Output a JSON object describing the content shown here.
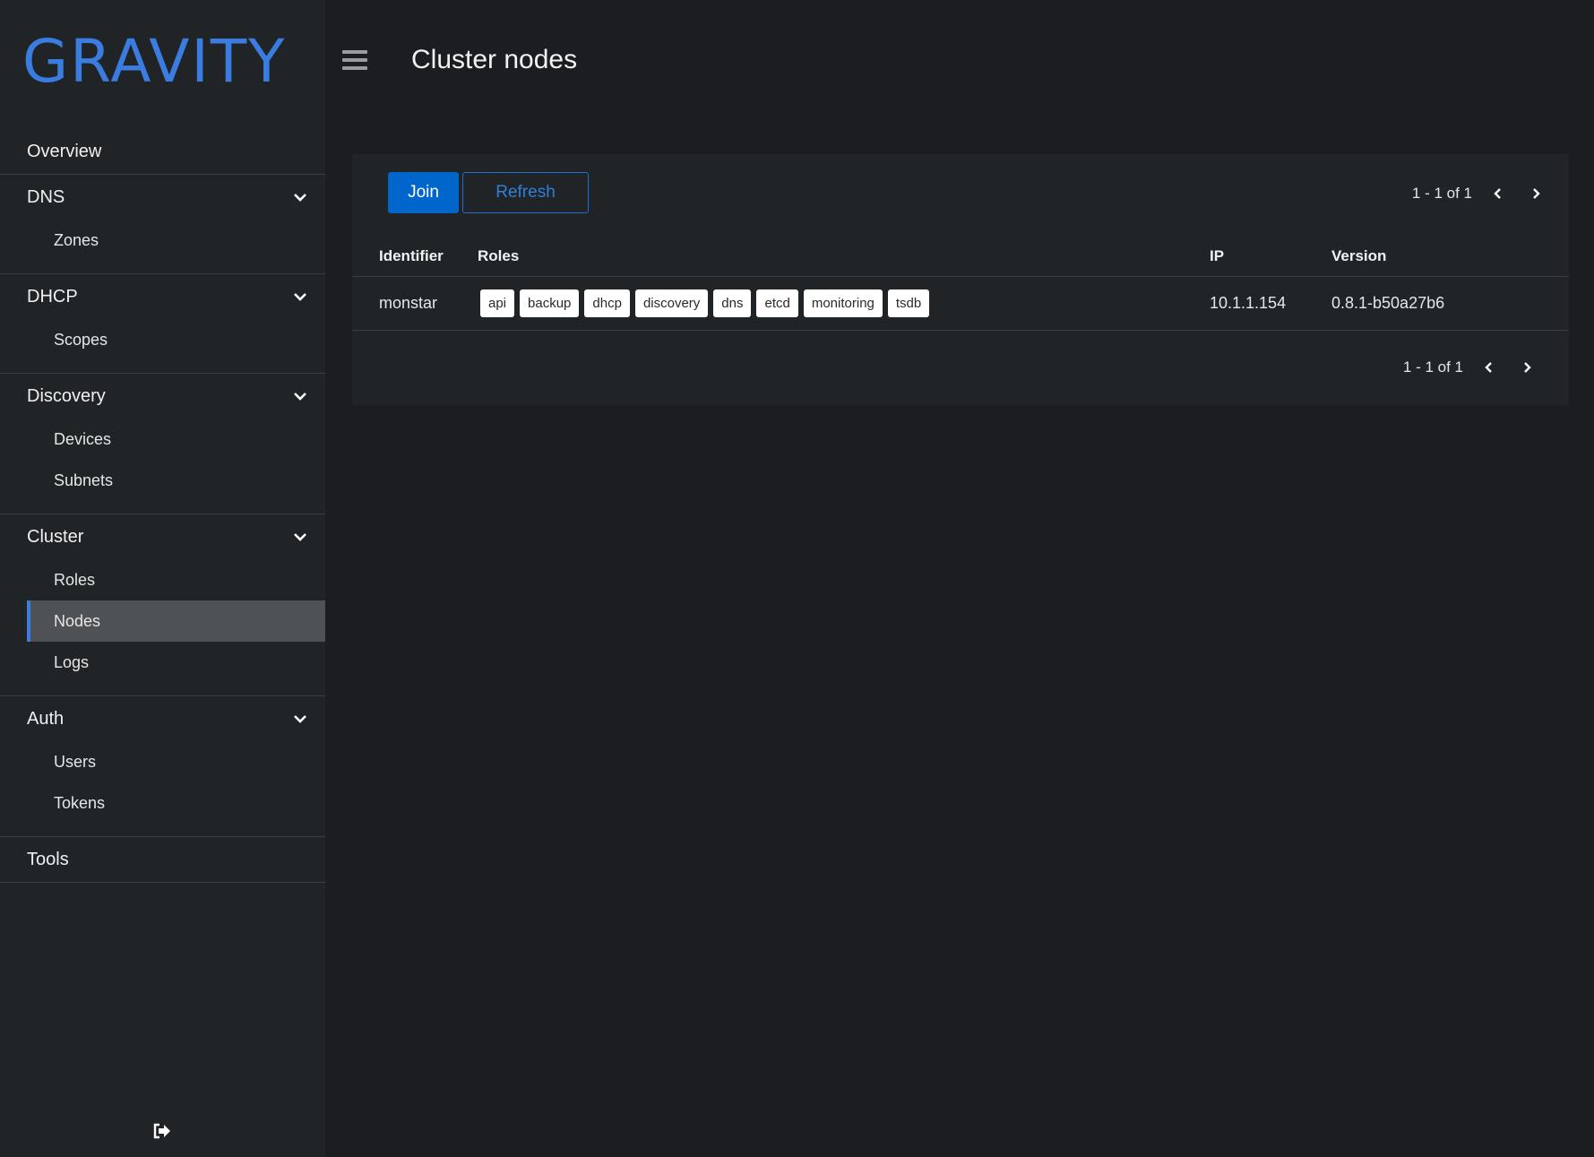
{
  "brand": {
    "logo_text": "GRAVITY",
    "accent": "#3b7ce0"
  },
  "header": {
    "title": "Cluster nodes"
  },
  "sidebar": {
    "groups": [
      {
        "label": "Overview",
        "items": []
      },
      {
        "label": "DNS",
        "items": [
          {
            "label": "Zones"
          }
        ]
      },
      {
        "label": "DHCP",
        "items": [
          {
            "label": "Scopes"
          }
        ]
      },
      {
        "label": "Discovery",
        "items": [
          {
            "label": "Devices"
          },
          {
            "label": "Subnets"
          }
        ]
      },
      {
        "label": "Cluster",
        "items": [
          {
            "label": "Roles"
          },
          {
            "label": "Nodes",
            "active": true
          },
          {
            "label": "Logs"
          }
        ]
      },
      {
        "label": "Auth",
        "items": [
          {
            "label": "Users"
          },
          {
            "label": "Tokens"
          }
        ]
      },
      {
        "label": "Tools",
        "items": []
      }
    ]
  },
  "toolbar": {
    "join_label": "Join",
    "refresh_label": "Refresh"
  },
  "pagination": {
    "range_text": "1 - 1 of 1"
  },
  "table": {
    "columns": [
      "Identifier",
      "Roles",
      "IP",
      "Version"
    ],
    "rows": [
      {
        "identifier": "monstar",
        "roles": [
          "api",
          "backup",
          "dhcp",
          "discovery",
          "dns",
          "etcd",
          "monitoring",
          "tsdb"
        ],
        "ip": "10.1.1.154",
        "version": "0.8.1-b50a27b6"
      }
    ]
  },
  "icons": {
    "menu": "hamburger-icon",
    "expand": "chevron-down-icon",
    "prev": "chevron-left-icon",
    "next": "chevron-right-icon",
    "logout": "logout-icon"
  }
}
